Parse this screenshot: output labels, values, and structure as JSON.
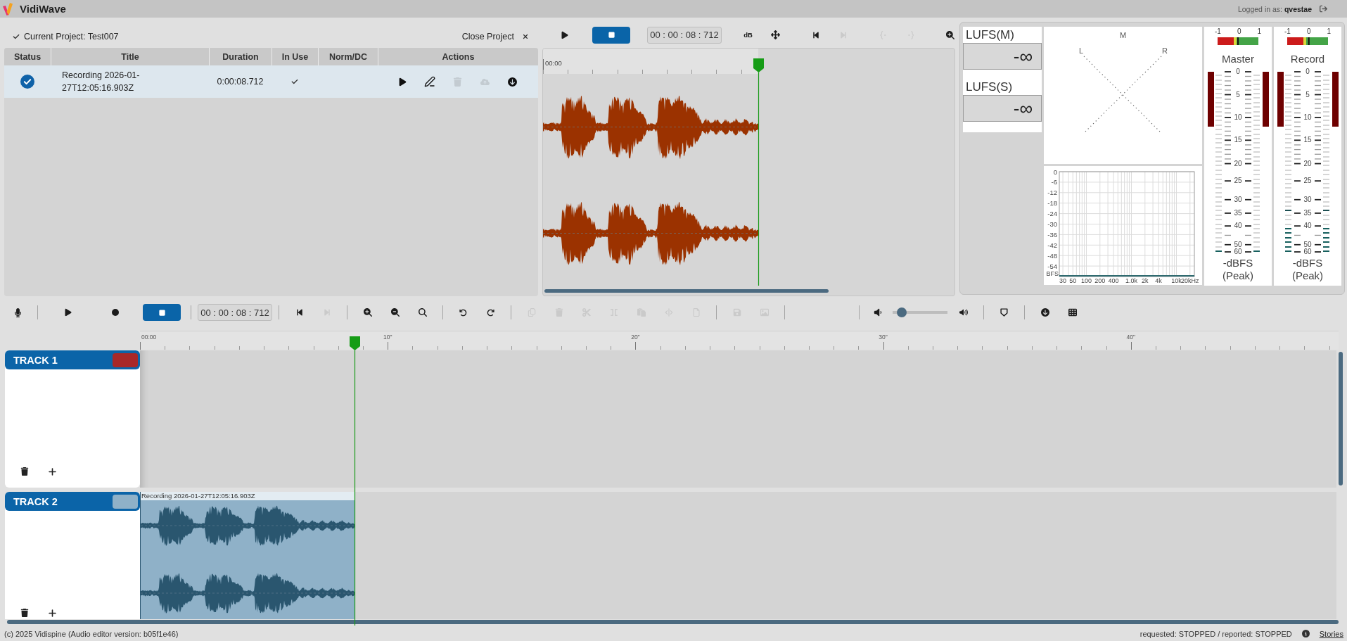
{
  "header": {
    "title": "VidiWave",
    "user": "Logged in as: **qvestae**"
  },
  "project": {
    "name": "Current Project: Test007",
    "close_label": "Close Project"
  },
  "recordings": {
    "columns": [
      "Status",
      "Title",
      "Duration",
      "In Use",
      "Norm/DC",
      "Actions"
    ],
    "rows": [
      {
        "selected": true,
        "complete": true,
        "title": "Recording 2026-01-27T12:05:16.903Z",
        "duration": "0:00:08.712",
        "in_use": true,
        "actions": [
          {
            "kind": "play",
            "disabled": false
          },
          {
            "kind": "edit",
            "disabled": false
          },
          {
            "kind": "delete",
            "disabled": true
          },
          {
            "kind": "upload",
            "disabled": true
          },
          {
            "kind": "download",
            "disabled": false
          }
        ]
      }
    ]
  },
  "preview": {
    "toolbar": [
      [
        {
          "kind": "play",
          "disabled": false
        },
        {
          "kind": "stop",
          "disabled": false
        }
      ],
      [
        {
          "kind": "time",
          "text": "00 : 00 : 08 : 712"
        }
      ],
      [
        {
          "kind": "db",
          "label": "dB",
          "disabled": false
        },
        {
          "kind": "move",
          "disabled": false
        }
      ],
      [
        {
          "kind": "skip-start",
          "disabled": false
        },
        {
          "kind": "skip-end",
          "disabled": true
        }
      ],
      [
        {
          "kind": "brace-left",
          "disabled": true
        },
        {
          "kind": "brace-right",
          "disabled": true
        }
      ],
      [
        {
          "kind": "zoom-in",
          "disabled": false
        }
      ]
    ],
    "ruler_label": "00:00"
  },
  "meters": {
    "loudness": [
      {
        "label": "LUFS(M)",
        "value": "-∞"
      },
      {
        "label": "LUFS(S)",
        "value": "-∞"
      }
    ],
    "goniometer": {
      "top": "M",
      "left": "L",
      "right": "R"
    },
    "spectrum": {
      "y_labels": [
        "0",
        "-6",
        "-12",
        "-18",
        "-24",
        "-30",
        "-36",
        "-42",
        "-48",
        "-54"
      ],
      "unit": "BFS",
      "x_labels": [
        "30",
        "50",
        "100",
        "200",
        "400",
        "1.0k",
        "2k",
        "4k",
        "10k",
        "20kHz"
      ]
    },
    "levels": [
      {
        "name": "Master",
        "correlation": {
          "labels": [
            "-1",
            "0",
            "1"
          ],
          "level": 0.5
        },
        "scale": [
          "0",
          "5",
          "10",
          "15",
          "20",
          "25",
          "30",
          "35",
          "40",
          "50",
          "60"
        ],
        "channels": [
          {
            "level": 0.01
          },
          {
            "level": 0.01
          }
        ],
        "unit": "-dBFS",
        "mode": "(Peak)"
      },
      {
        "name": "Record",
        "correlation": {
          "labels": [
            "-1",
            "0",
            "1"
          ],
          "level": 0.53
        },
        "scale": [
          "0",
          "5",
          "10",
          "15",
          "20",
          "25",
          "30",
          "35",
          "40",
          "50",
          "60"
        ],
        "channels": [
          {
            "level": 0.15,
            "peak": {
              "level": 0.225
            }
          },
          {
            "level": 0.15,
            "peak": {
              "level": 0.225
            }
          }
        ],
        "unit": "-dBFS",
        "mode": "(Peak)"
      }
    ]
  },
  "editor_toolbar": [
    {
      "kind": "mic",
      "disabled": false
    },
    {
      "kind": "separator"
    },
    {
      "kind": "play",
      "disabled": false
    },
    {
      "kind": "record",
      "disabled": false
    },
    {
      "kind": "stop",
      "disabled": false
    },
    {
      "kind": "separator"
    },
    {
      "kind": "time",
      "text": "00 : 00 : 08 : 712"
    },
    {
      "kind": "separator"
    },
    {
      "kind": "skip-start",
      "disabled": false
    },
    {
      "kind": "skip-end",
      "disabled": true
    },
    {
      "kind": "separator"
    },
    {
      "kind": "zoom-in",
      "disabled": false
    },
    {
      "kind": "zoom-out",
      "disabled": false
    },
    {
      "kind": "zoom-fit",
      "disabled": false
    },
    {
      "kind": "separator"
    },
    {
      "kind": "undo",
      "disabled": false
    },
    {
      "kind": "redo",
      "disabled": false
    },
    {
      "kind": "separator"
    },
    {
      "kind": "copy",
      "disabled": true
    },
    {
      "kind": "trash",
      "disabled": true
    },
    {
      "kind": "scissors",
      "disabled": true
    },
    {
      "kind": "brackets",
      "disabled": true
    },
    {
      "kind": "clipboard",
      "disabled": true
    },
    {
      "kind": "split",
      "disabled": true
    },
    {
      "kind": "file",
      "disabled": true
    },
    {
      "kind": "separator"
    },
    {
      "kind": "save",
      "disabled": true
    },
    {
      "kind": "image",
      "disabled": true
    },
    {
      "kind": "separator"
    },
    {
      "kind": "separator"
    },
    {
      "kind": "volume-down",
      "disabled": false
    },
    {
      "kind": "volume",
      "level": 0.1
    },
    {
      "kind": "volume-up",
      "disabled": false
    },
    {
      "kind": "separator"
    },
    {
      "kind": "shield",
      "disabled": false
    },
    {
      "kind": "separator"
    },
    {
      "kind": "download",
      "disabled": false
    },
    {
      "kind": "grid",
      "disabled": false
    }
  ],
  "timeline": {
    "ruler": [
      "00:00",
      "10\"",
      "20\"",
      "30\"",
      "40\""
    ],
    "tracks": [
      {
        "name": "TRACK 1",
        "color": "#a82828"
      },
      {
        "name": "TRACK 2",
        "color": "#8fb1c8",
        "clips": [
          {
            "title": "Recording 2026-01-27T12:05:16.903Z"
          }
        ]
      }
    ]
  },
  "footer": {
    "copyright": "(c) 2025 Vidispine (Audio editor version: b05f1e46)",
    "status": "requested: STOPPED / reported: STOPPED",
    "link": "Stories"
  }
}
